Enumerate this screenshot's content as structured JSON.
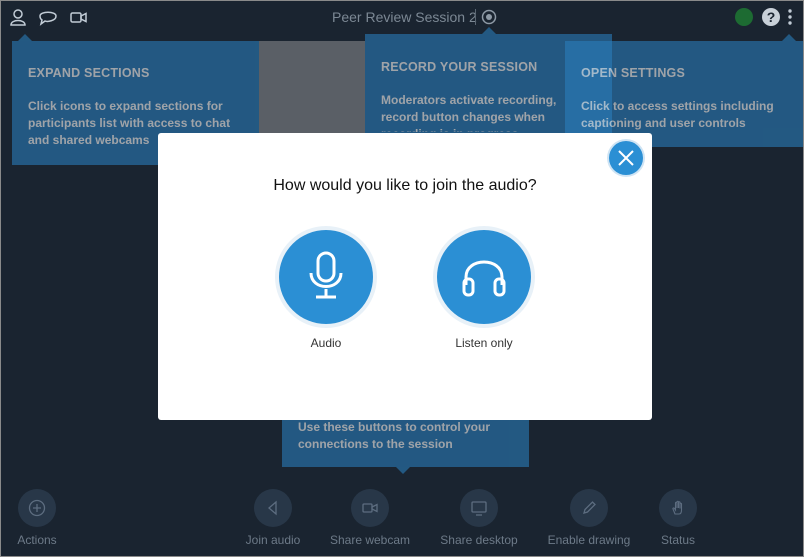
{
  "header": {
    "title": "Peer Review Session 2",
    "icons": [
      "user-icon",
      "chat-icon",
      "webcam-icon",
      "record-icon",
      "status-dot",
      "help-icon",
      "kebab-menu-icon"
    ],
    "help_glyph": "?"
  },
  "tooltips": {
    "expand": {
      "title": "EXPAND SECTIONS",
      "body": "Click icons to expand sections for participants list with access to chat and shared webcams"
    },
    "record": {
      "title": "RECORD YOUR SESSION",
      "body": "Moderators activate recording, record button changes when recording is in progress"
    },
    "settings": {
      "title": "OPEN SETTINGS",
      "body": "Click to access settings including captioning and user controls"
    },
    "controls": {
      "body": "Use these buttons to control your connections to the session"
    }
  },
  "modal": {
    "title": "How would you like to join the audio?",
    "options": [
      {
        "label": "Audio",
        "icon": "microphone-icon"
      },
      {
        "label": "Listen only",
        "icon": "headphones-icon"
      }
    ],
    "close_icon": "close-icon"
  },
  "bottombar": {
    "buttons": [
      {
        "label": "Actions",
        "icon": "plus-icon"
      },
      {
        "label": "Join audio",
        "icon": "audio-icon"
      },
      {
        "label": "Share webcam",
        "icon": "webcam-icon"
      },
      {
        "label": "Share desktop",
        "icon": "desktop-icon"
      },
      {
        "label": "Enable drawing",
        "icon": "pencil-icon"
      },
      {
        "label": "Status",
        "icon": "hand-icon"
      }
    ]
  },
  "colors": {
    "background": "#1a2430",
    "accent": "#2b8fd4",
    "tooltip": "#2b7fbe",
    "status_online": "#1d6b32"
  }
}
